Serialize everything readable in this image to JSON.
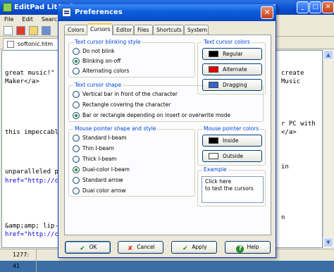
{
  "bgwindow": {
    "title": "EditPad Lite - [",
    "menu": [
      "File",
      "Edit",
      "Search"
    ],
    "file_tab": "softonic.htm",
    "editor_left": [
      {
        "text": "great music!\"",
        "link": false
      },
      {
        "text": "Maker</a>",
        "link": false
      },
      {
        "text": "this impeccabl",
        "link": false
      },
      {
        "text": "unparalleled p",
        "link": false
      },
      {
        "text": "href=\"http://c",
        "link": true
      },
      {
        "text": "&amp;amp; lip-",
        "link": false
      },
      {
        "text": "href=\"http://c",
        "link": true
      }
    ],
    "editor_right": [
      "create",
      "Music",
      "r PC with",
      "</a>",
      "in",
      "n"
    ],
    "status_position": "1277: 41"
  },
  "dialog": {
    "title": "Preferences",
    "close_glyph": "✕",
    "tabs": [
      "Colors",
      "Cursors",
      "Editor",
      "Files",
      "Shortcuts",
      "System"
    ],
    "active_tab": "Cursors",
    "text_cursor_blinking": {
      "label": "Text cursor blinking style",
      "options": [
        "Do not blink",
        "Blinking on-off",
        "Alternating colors"
      ],
      "selected": "Blinking on-off"
    },
    "text_cursor_shape": {
      "label": "Text cursor shape",
      "options": [
        "Vertical bar in front of the character",
        "Rectangle covering the character",
        "Bar or rectangle depending on insert or overwrite mode"
      ],
      "selected": "Bar or rectangle depending on insert or overwrite mode"
    },
    "mouse_pointer": {
      "label": "Mouse pointer shape and style",
      "options": [
        "Standard I-beam",
        "Thin I-beam",
        "Thick I-beam",
        "Dual-color I-beam",
        "Standard arrow",
        "Dual color arrow"
      ],
      "selected": "Dual-color I-beam"
    },
    "text_cursor_colors": {
      "label": "Text cursor colors",
      "buttons": [
        {
          "label": "Regular",
          "color": "#000000"
        },
        {
          "label": "Alternate",
          "color": "#e60000"
        },
        {
          "label": "Dragging",
          "color": "#3366cc"
        }
      ]
    },
    "mouse_pointer_colors": {
      "label": "Mouse pointer colors",
      "buttons": [
        {
          "label": "Inside",
          "color": "#000000"
        },
        {
          "label": "Outside",
          "color": "#ffffff"
        }
      ]
    },
    "example": {
      "label": "Example",
      "line1": "Click here",
      "line2": "to test the cursors"
    },
    "buttons": {
      "ok": "OK",
      "cancel": "Cancel",
      "apply": "Apply",
      "help": "Help"
    }
  }
}
